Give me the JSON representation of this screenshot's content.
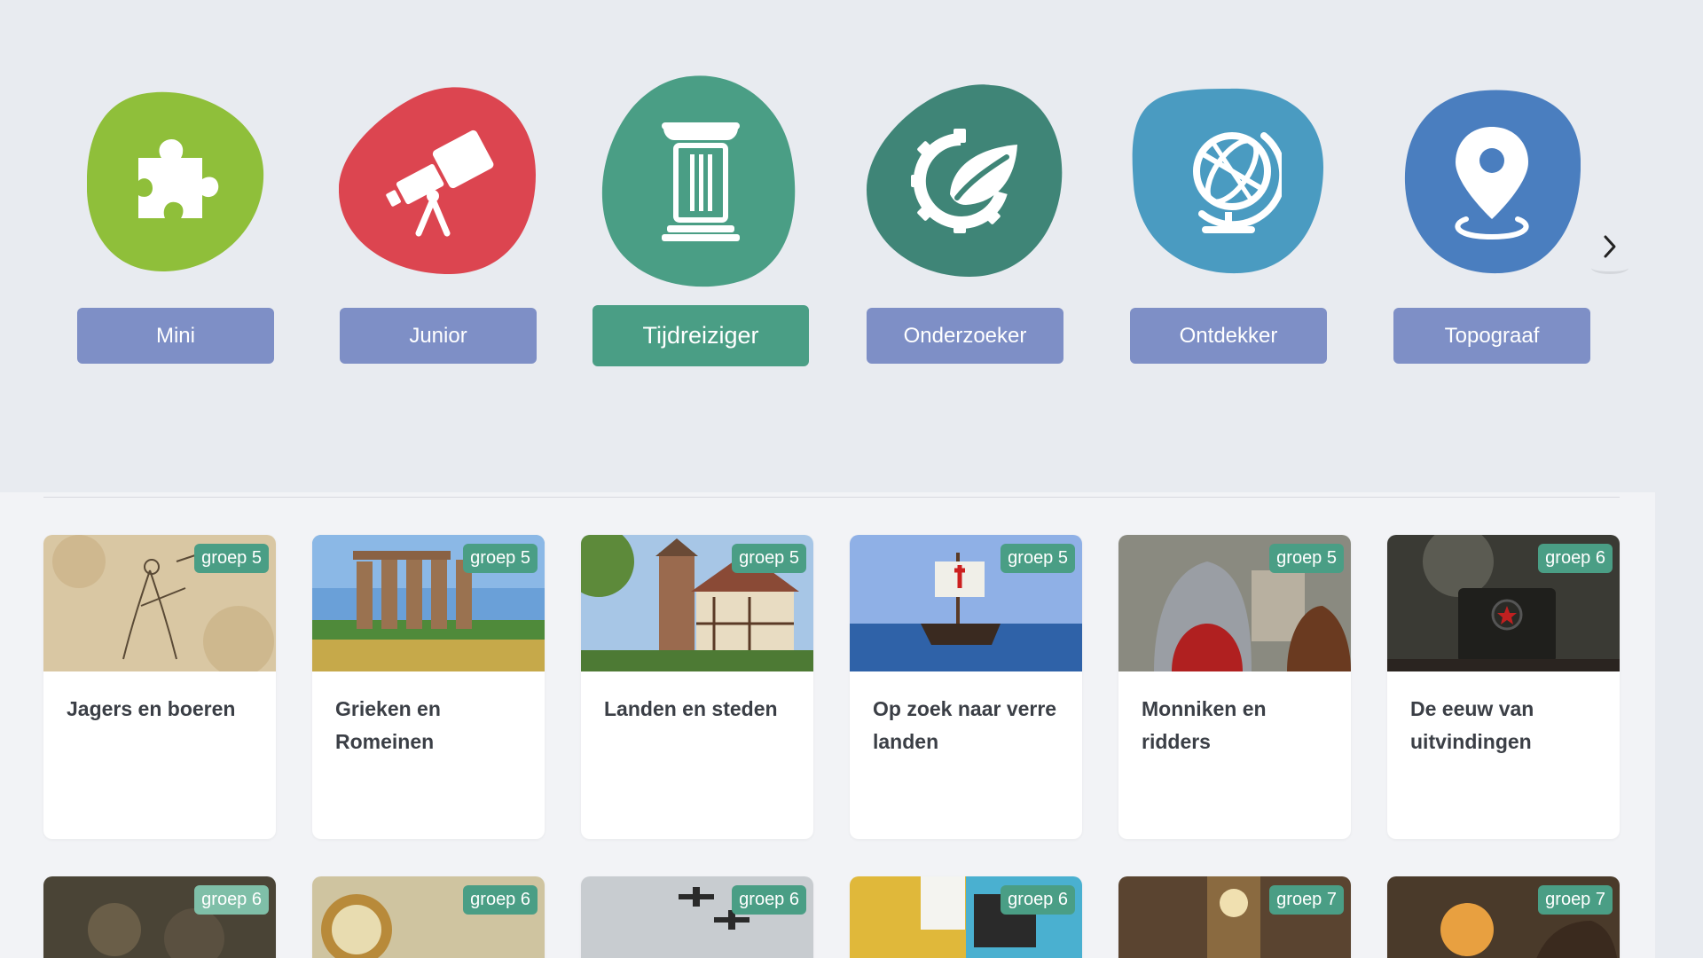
{
  "levels": [
    {
      "label": "Mini",
      "color": "#8fbf3a",
      "icon": "puzzle-icon",
      "active": false
    },
    {
      "label": "Junior",
      "color": "#dc4550",
      "icon": "telescope-icon",
      "active": false
    },
    {
      "label": "Tijdreiziger",
      "color": "#4a9e85",
      "icon": "column-icon",
      "active": true
    },
    {
      "label": "Onderzoeker",
      "color": "#3f8577",
      "icon": "gear-leaf-icon",
      "active": false
    },
    {
      "label": "Ontdekker",
      "color": "#4a9bc1",
      "icon": "globe-icon",
      "active": false
    },
    {
      "label": "Topograaf",
      "color": "#4a7ebf",
      "icon": "map-pin-icon",
      "active": false
    }
  ],
  "cards_row1": [
    {
      "badge": "groep 5",
      "title": "Jagers en boeren"
    },
    {
      "badge": "groep 5",
      "title": "Grieken en Romeinen"
    },
    {
      "badge": "groep 5",
      "title": "Landen en steden"
    },
    {
      "badge": "groep 5",
      "title": "Op zoek naar verre landen"
    },
    {
      "badge": "groep 5",
      "title": "Monniken en ridders"
    },
    {
      "badge": "groep 6",
      "title": "De eeuw van uitvindingen"
    }
  ],
  "cards_row2": [
    {
      "badge": "groep 6"
    },
    {
      "badge": "groep 6"
    },
    {
      "badge": "groep 6"
    },
    {
      "badge": "groep 6"
    },
    {
      "badge": "groep 7"
    },
    {
      "badge": "groep 7"
    }
  ]
}
